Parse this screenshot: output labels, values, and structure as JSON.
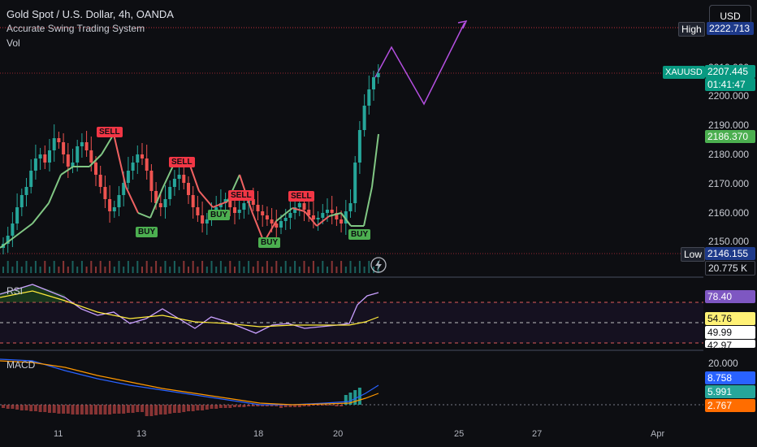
{
  "header": {
    "symbol_line": "Gold Spot / U.S. Dollar, 4h, OANDA",
    "indicator_1": "Accurate Swing Trading System",
    "indicator_2": "Vol",
    "currency_button": "USD"
  },
  "price_axis": {
    "ticks": [
      "2222.713",
      "2210.000",
      "2200.000",
      "2190.000",
      "2180.000",
      "2170.000",
      "2160.000",
      "2150.000"
    ],
    "high_tag": "High",
    "high_value": "2222.713",
    "symbol_tag": "XAUUSD",
    "current_price": "2207.445",
    "countdown": "01:41:47",
    "green_level": "2186.370",
    "low_tag": "Low",
    "low_value": "2146.155",
    "volume_value": "20.775 K"
  },
  "signals": {
    "sell_labels": [
      "SELL",
      "SELL",
      "SELL",
      "SELL"
    ],
    "buy_labels": [
      "BUY",
      "BUY",
      "BUY",
      "BUY"
    ]
  },
  "rsi_pane": {
    "title": "RSI",
    "value_main": "78.40",
    "value_signal": "54.76",
    "level_mid": "49.99",
    "level_low": "42.97"
  },
  "macd_pane": {
    "title": "MACD",
    "scale_top": "20.000",
    "macd_value": "8.758",
    "signal_value": "5.991",
    "hist_value": "2.767"
  },
  "time_axis": {
    "labels": [
      "11",
      "13",
      "18",
      "20",
      "25",
      "27",
      "Apr"
    ]
  },
  "colors": {
    "bull": "#26a69a",
    "bear": "#ef5350",
    "buy_green": "#4caf50",
    "sell_red": "#f23645",
    "trend_green": "#81c784",
    "trend_red": "#f06262",
    "projection": "#b44fe0",
    "rsi_purple": "#7e57c2",
    "macd_blue": "#2962ff",
    "signal_orange": "#ff6d00"
  }
}
